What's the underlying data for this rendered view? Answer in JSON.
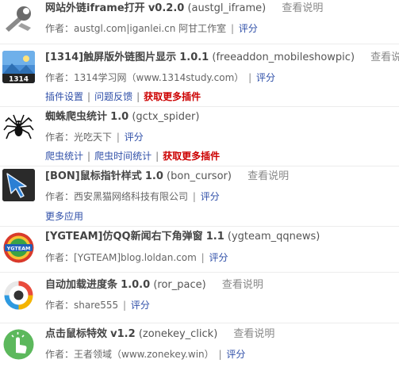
{
  "common": {
    "doc_label": "查看说明",
    "author_prefix": "作者：",
    "score_label": "评分",
    "separator": "|"
  },
  "plugins": [
    {
      "name": "网站外链iframe打开",
      "version": "v0.2.0",
      "id": "(austgl_iframe)",
      "author": "austgl.com|iganlei.cn 阿甘工作室",
      "icon": "wrench-icon",
      "links": []
    },
    {
      "name": "[1314]触屏版外链图片显示",
      "version": "1.0.1",
      "id": "(freeaddon_mobileshowpic)",
      "author": "1314学习网（www.1314study.com）",
      "icon": "landscape-1314-icon",
      "icon_text": "1314",
      "links": [
        {
          "label": "插件设置",
          "style": "link"
        },
        {
          "label": "问题反馈",
          "style": "link"
        },
        {
          "label": "获取更多插件",
          "style": "get"
        }
      ]
    },
    {
      "name": "蜘蛛爬虫统计",
      "version": "1.0",
      "id": "(gctx_spider)",
      "author": "光吃天下",
      "icon": "spider-icon",
      "links": [
        {
          "label": "爬虫统计",
          "style": "link"
        },
        {
          "label": "爬虫时间统计",
          "style": "link"
        },
        {
          "label": "获取更多插件",
          "style": "get"
        }
      ]
    },
    {
      "name": "[BON]鼠标指针样式",
      "version": "1.0",
      "id": "(bon_cursor)",
      "author": "西安黑猫网络科技有限公司",
      "icon": "cursor-icon",
      "links": [
        {
          "label": "更多应用",
          "style": "link"
        }
      ]
    },
    {
      "name": "[YGTEAM]仿QQ新闻右下角弹窗",
      "version": "1.1",
      "id": "(ygteam_qqnews)",
      "author": "[YGTEAM]blog.loldan.com",
      "icon": "ygteam-logo-icon",
      "icon_text": "YGTEAM",
      "links": []
    },
    {
      "name": "自动加载进度条",
      "version": "1.0.0",
      "id": "(ror_pace)",
      "author": "share555",
      "icon": "progress-ring-icon",
      "links": []
    },
    {
      "name": "点击鼠标特效",
      "version": "v1.2",
      "id": "(zonekey_click)",
      "author": "王者领域（www.zonekey.win）",
      "icon": "click-hand-icon",
      "links": []
    }
  ]
}
